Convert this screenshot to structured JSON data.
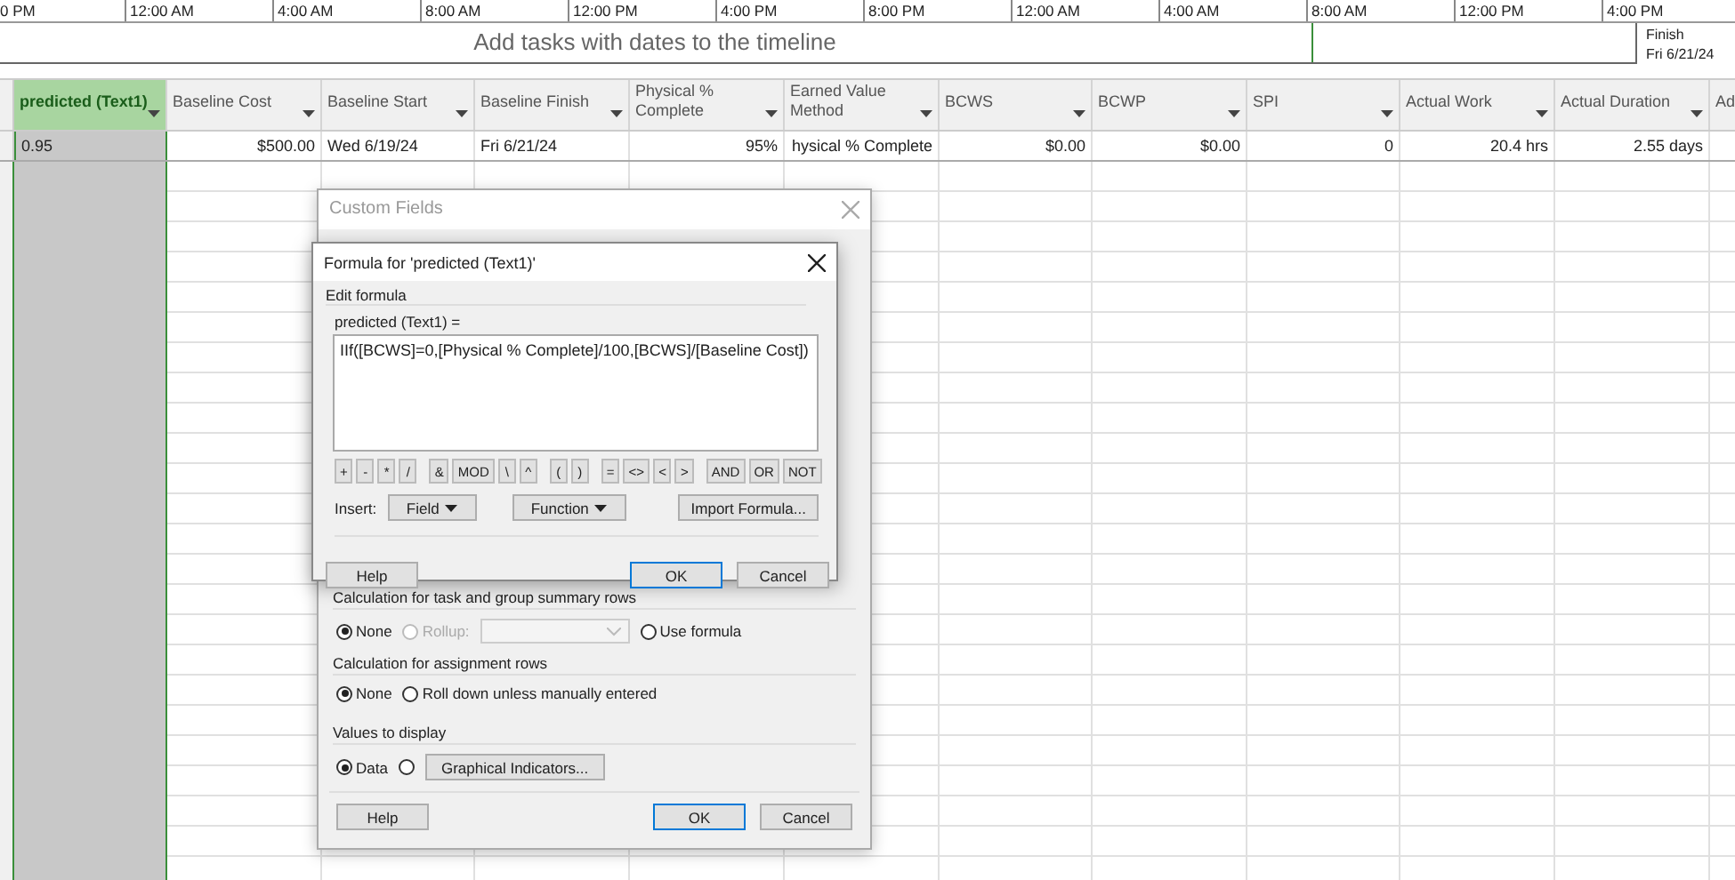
{
  "timeline": {
    "ticks": [
      "0 PM",
      "12:00 AM",
      "4:00 AM",
      "8:00 AM",
      "12:00 PM",
      "4:00 PM",
      "8:00 PM",
      "12:00 AM",
      "4:00 AM",
      "8:00 AM",
      "12:00 PM",
      "4:00 PM"
    ],
    "placeholder": "Add tasks with dates to the timeline",
    "finish_label": "Finish",
    "finish_date": "Fri 6/21/24"
  },
  "table": {
    "columns": [
      {
        "label": "predicted (Text1)",
        "selected": true
      },
      {
        "label": "Baseline Cost",
        "selected": false
      },
      {
        "label": "Baseline Start",
        "selected": false
      },
      {
        "label": "Baseline Finish",
        "selected": false
      },
      {
        "label": "Physical % Complete",
        "selected": false
      },
      {
        "label": "Earned Value Method",
        "selected": false
      },
      {
        "label": "BCWS",
        "selected": false
      },
      {
        "label": "BCWP",
        "selected": false
      },
      {
        "label": "SPI",
        "selected": false
      },
      {
        "label": "Actual Work",
        "selected": false
      },
      {
        "label": "Actual Duration",
        "selected": false
      },
      {
        "label": "Ad",
        "selected": false
      }
    ],
    "rows": [
      {
        "cells": [
          "0.95",
          "$500.00",
          "Wed 6/19/24",
          "Fri 6/21/24",
          "95%",
          "hysical % Complete",
          "$0.00",
          "$0.00",
          "0",
          "20.4 hrs",
          "2.55 days",
          ""
        ]
      }
    ]
  },
  "custom_fields_dialog": {
    "title": "Custom Fields",
    "summary_section": {
      "label": "Calculation for task and group summary rows",
      "options": [
        {
          "label": "None",
          "selected": true,
          "disabled": false
        },
        {
          "label": "Rollup:",
          "selected": false,
          "disabled": true
        },
        {
          "label": "Use formula",
          "selected": false,
          "disabled": false
        }
      ]
    },
    "assignment_section": {
      "label": "Calculation for assignment rows",
      "options": [
        {
          "label": "None",
          "selected": true
        },
        {
          "label": "Roll down unless manually entered",
          "selected": false
        }
      ]
    },
    "display_section": {
      "label": "Values to display",
      "options": [
        {
          "label": "Data",
          "selected": true
        },
        {
          "selected": false
        }
      ],
      "button": "Graphical Indicators..."
    },
    "buttons": [
      "Help",
      "OK",
      "Cancel"
    ]
  },
  "formula_dialog": {
    "title": "Formula for 'predicted (Text1)'",
    "group_label": "Edit formula",
    "field_label": "predicted (Text1) =",
    "formula": "IIf([BCWS]=0,[Physical % Complete]/100,[BCWS]/[Baseline Cost])",
    "operator_groups": [
      [
        "+",
        "-",
        "*",
        "/"
      ],
      [
        "&",
        "MOD",
        "\\",
        "^"
      ],
      [
        "(",
        ")"
      ],
      [
        "=",
        "<>",
        "<",
        ">"
      ],
      [
        "AND",
        "OR",
        "NOT"
      ]
    ],
    "insert_label": "Insert:",
    "insert_buttons": [
      "Field",
      "Function"
    ],
    "import_button": "Import Formula...",
    "buttons": [
      "Help",
      "OK",
      "Cancel"
    ]
  }
}
